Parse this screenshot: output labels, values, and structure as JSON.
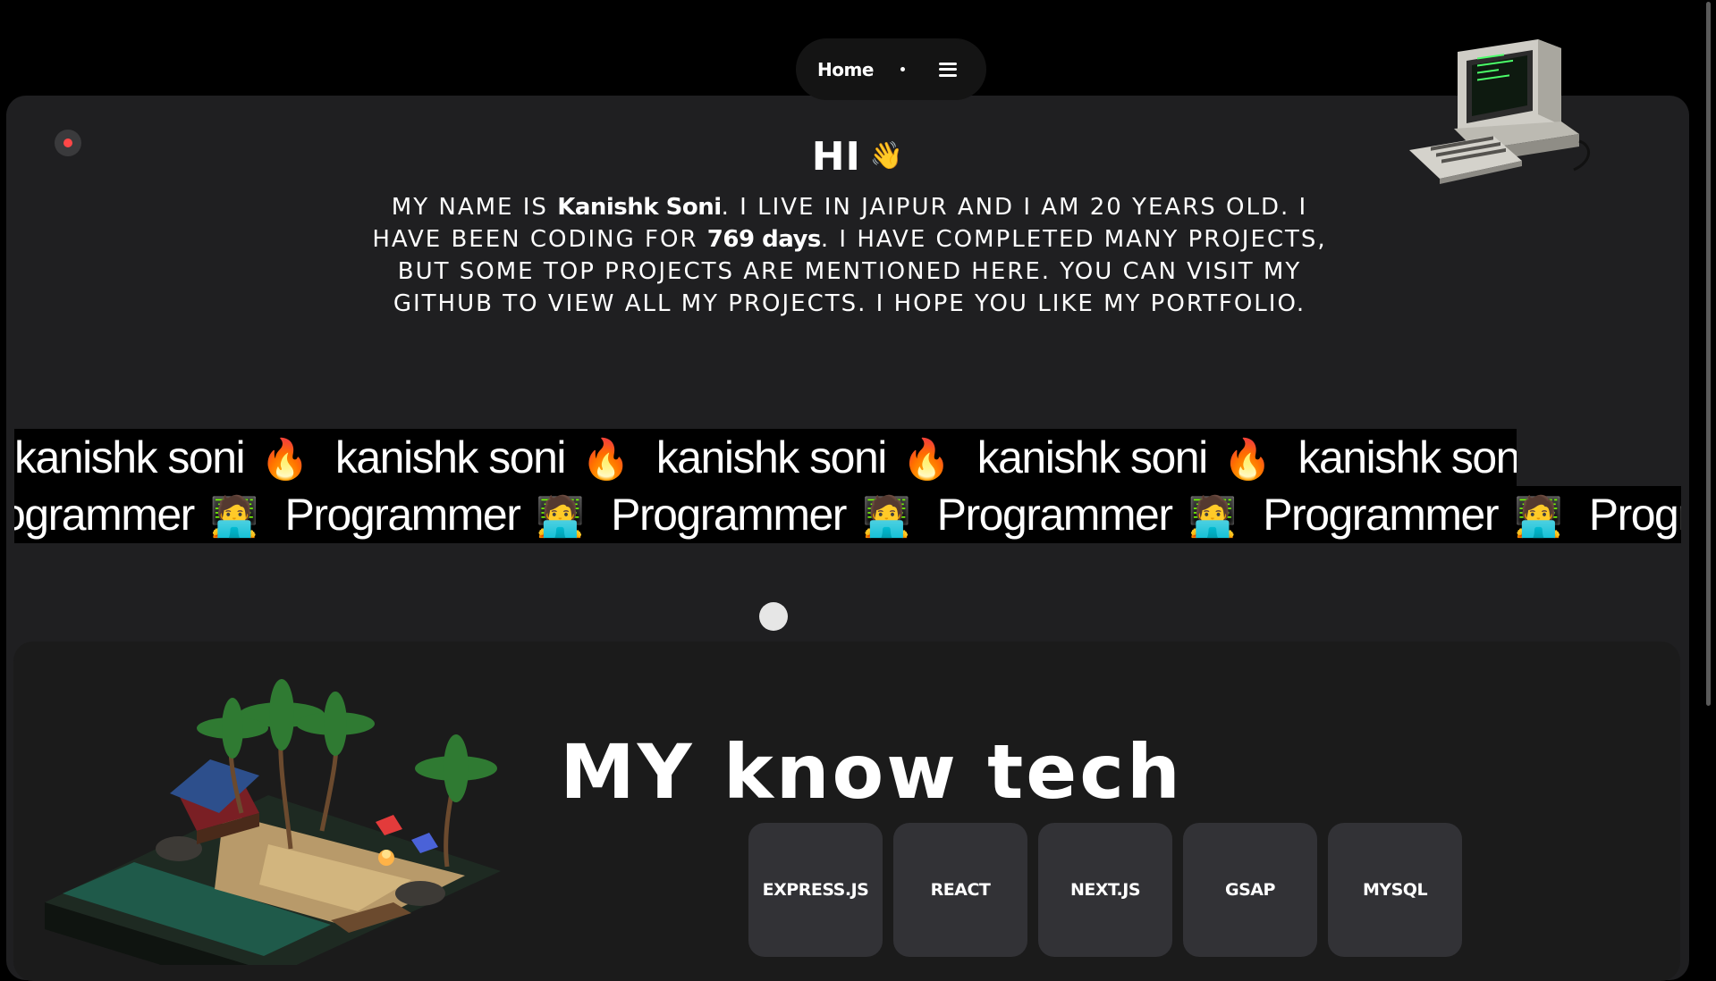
{
  "nav": {
    "home_label": "Home",
    "icons": [
      "dot-icon",
      "hamburger-menu-icon"
    ]
  },
  "hero": {
    "greeting": "HI",
    "greeting_emoji": "👋",
    "intro_part1": "My name is ",
    "name": "Kanishk Soni",
    "intro_part2": ". I live in Jaipur and I am 20 years old. I have been coding for ",
    "days": "769 days",
    "intro_part3": ". I have completed many projects, but some top projects are mentioned here. You can visit my github to view all my projects. I hope you like my portfolio."
  },
  "marquee": {
    "name_text": "kanishk soni",
    "name_emoji": "🔥",
    "role_text": "Programmer",
    "role_emoji": "🧑‍💻"
  },
  "tech": {
    "title": "MY know tech",
    "cards": [
      "EXPRESS.JS",
      "REACT",
      "NEXT.JS",
      "GSAP",
      "MYSQL"
    ]
  },
  "colors": {
    "background": "#000000",
    "panel": "#1f1f21",
    "card": "#323236",
    "record_dot": "#ff4747"
  }
}
